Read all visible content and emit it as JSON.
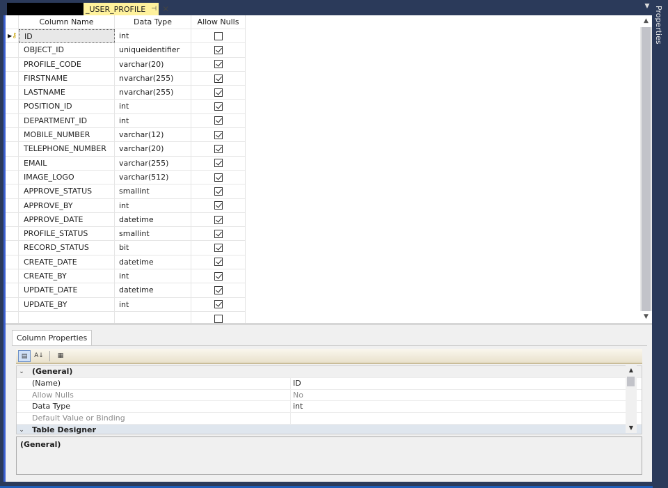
{
  "tab": {
    "title": "_USER_PROFILE",
    "pin_icon": "pin-icon",
    "close_icon": "close-icon"
  },
  "right_panel": {
    "label": "Properties"
  },
  "grid": {
    "headers": {
      "name": "Column Name",
      "type": "Data Type",
      "nulls": "Allow Nulls"
    },
    "rows": [
      {
        "name": "ID",
        "type": "int",
        "nulls": false
      },
      {
        "name": "OBJECT_ID",
        "type": "uniqueidentifier",
        "nulls": true
      },
      {
        "name": "PROFILE_CODE",
        "type": "varchar(20)",
        "nulls": true
      },
      {
        "name": "FIRSTNAME",
        "type": "nvarchar(255)",
        "nulls": true
      },
      {
        "name": "LASTNAME",
        "type": "nvarchar(255)",
        "nulls": true
      },
      {
        "name": "POSITION_ID",
        "type": "int",
        "nulls": true
      },
      {
        "name": "DEPARTMENT_ID",
        "type": "int",
        "nulls": true
      },
      {
        "name": "MOBILE_NUMBER",
        "type": "varchar(12)",
        "nulls": true
      },
      {
        "name": "TELEPHONE_NUMBER",
        "type": "varchar(20)",
        "nulls": true
      },
      {
        "name": "EMAIL",
        "type": "varchar(255)",
        "nulls": true
      },
      {
        "name": "IMAGE_LOGO",
        "type": "varchar(512)",
        "nulls": true
      },
      {
        "name": "APPROVE_STATUS",
        "type": "smallint",
        "nulls": true
      },
      {
        "name": "APPROVE_BY",
        "type": "int",
        "nulls": true
      },
      {
        "name": "APPROVE_DATE",
        "type": "datetime",
        "nulls": true
      },
      {
        "name": "PROFILE_STATUS",
        "type": "smallint",
        "nulls": true
      },
      {
        "name": "RECORD_STATUS",
        "type": "bit",
        "nulls": true
      },
      {
        "name": "CREATE_DATE",
        "type": "datetime",
        "nulls": true
      },
      {
        "name": "CREATE_BY",
        "type": "int",
        "nulls": true
      },
      {
        "name": "UPDATE_DATE",
        "type": "datetime",
        "nulls": true
      },
      {
        "name": "UPDATE_BY",
        "type": "int",
        "nulls": true
      },
      {
        "name": "",
        "type": "",
        "nulls": false
      }
    ]
  },
  "props": {
    "tab_label": "Column Properties",
    "categories": {
      "general": "(General)",
      "table_designer": "Table Designer"
    },
    "items": [
      {
        "name": "(Name)",
        "value": "ID",
        "dim": false
      },
      {
        "name": "Allow Nulls",
        "value": "No",
        "dim": true
      },
      {
        "name": "Data Type",
        "value": "int",
        "dim": false
      },
      {
        "name": "Default Value or Binding",
        "value": "",
        "dim": true
      }
    ],
    "description_title": "(General)"
  }
}
